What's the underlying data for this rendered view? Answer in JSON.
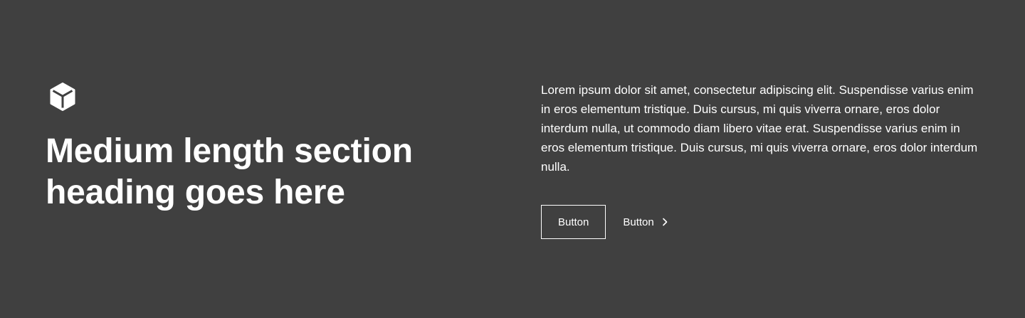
{
  "section": {
    "icon": "cube-icon",
    "heading": "Medium length section heading goes here",
    "body": "Lorem ipsum dolor sit amet, consectetur adipiscing elit. Suspendisse varius enim in eros elementum tristique. Duis cursus, mi quis viverra ornare, eros dolor interdum nulla, ut commodo diam libero vitae erat. Suspendisse varius enim in eros elementum tristique. Duis cursus, mi quis viverra ornare, eros dolor interdum nulla.",
    "primary_button": "Button",
    "secondary_button": "Button",
    "secondary_button_icon": "chevron-right-icon"
  },
  "colors": {
    "background": "#404040",
    "text": "#ffffff"
  }
}
